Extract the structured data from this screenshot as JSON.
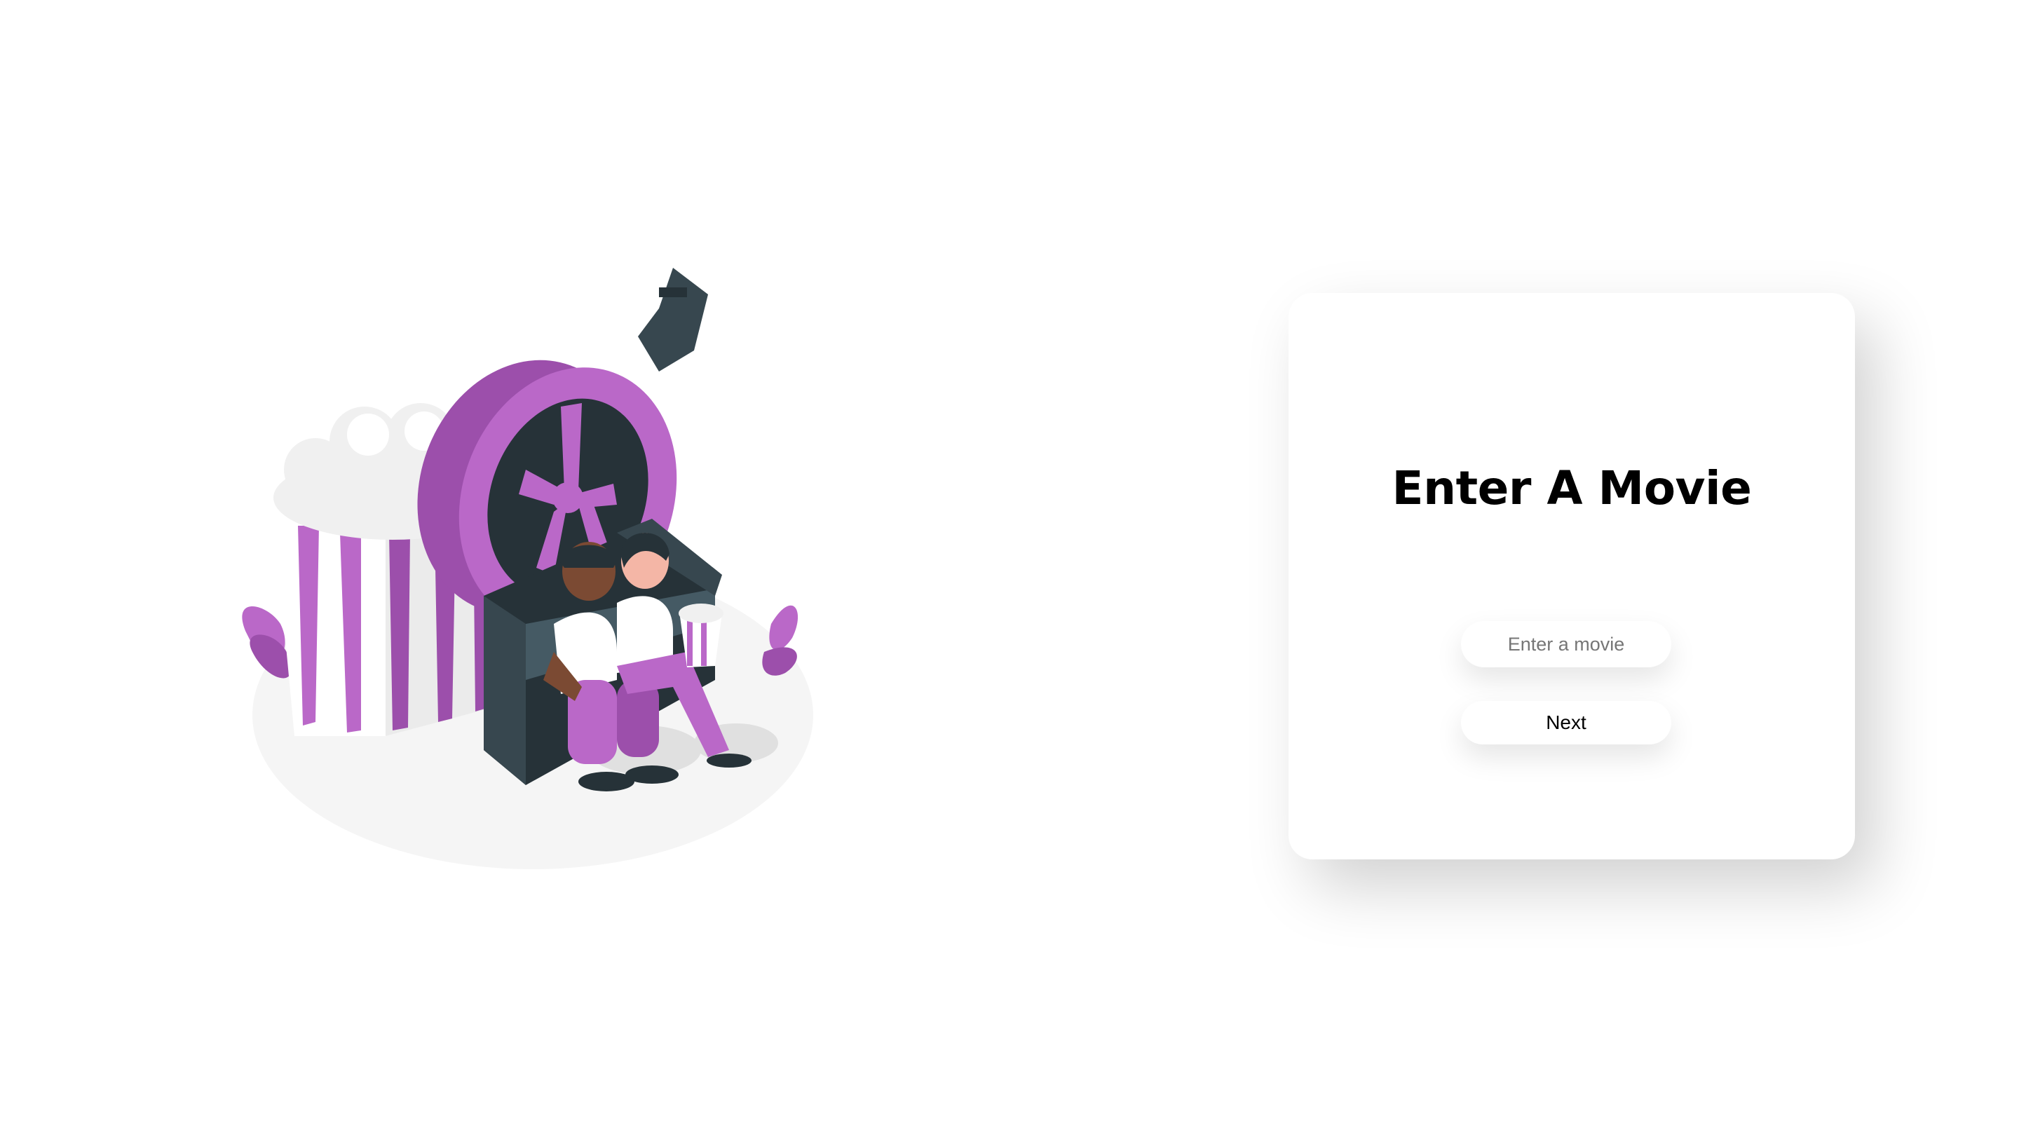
{
  "card": {
    "title": "Enter A Movie",
    "input_placeholder": "Enter a movie",
    "input_value": "",
    "next_label": "Next"
  },
  "illustration": {
    "subject": "couple-watching-movie",
    "accent": "#ba68c8",
    "dark": "#263238"
  }
}
